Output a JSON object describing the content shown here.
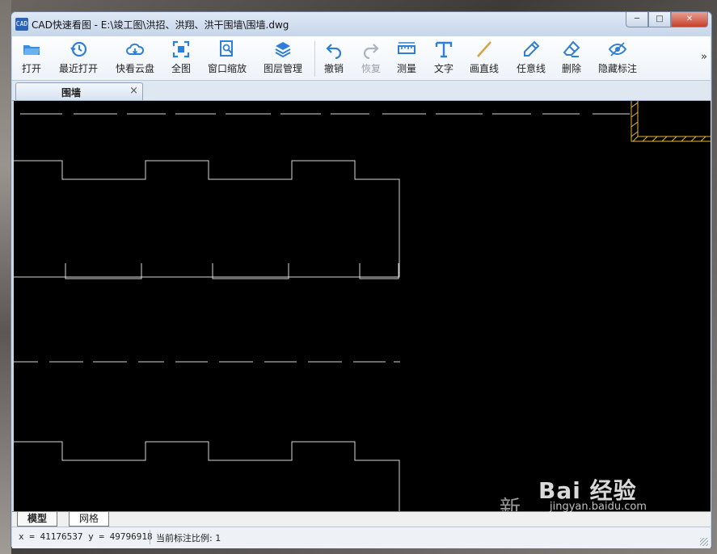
{
  "window": {
    "title": "CAD快速看图 - E:\\竣工图\\洪招、洪翔、洪干围墙\\围墙.dwg",
    "icon_text": "CAD",
    "min_label": "─",
    "max_label": "□",
    "close_label": "✕"
  },
  "toolbar": {
    "items": [
      {
        "label": "打开",
        "icon": "folder-open-icon",
        "enabled": true
      },
      {
        "label": "最近打开",
        "icon": "history-icon",
        "enabled": true
      },
      {
        "label": "快看云盘",
        "icon": "cloud-icon",
        "enabled": true
      },
      {
        "label": "全图",
        "icon": "fit-all-icon",
        "enabled": true
      },
      {
        "label": "窗口缩放",
        "icon": "zoom-window-icon",
        "enabled": true
      },
      {
        "label": "图层管理",
        "icon": "layers-icon",
        "enabled": true
      },
      {
        "label": "撤销",
        "icon": "undo-icon",
        "enabled": true
      },
      {
        "label": "恢复",
        "icon": "redo-icon",
        "enabled": false
      },
      {
        "label": "测量",
        "icon": "ruler-icon",
        "enabled": true
      },
      {
        "label": "文字",
        "icon": "text-icon",
        "enabled": true
      },
      {
        "label": "画直线",
        "icon": "line-icon",
        "enabled": true
      },
      {
        "label": "任意线",
        "icon": "pen-icon",
        "enabled": true
      },
      {
        "label": "删除",
        "icon": "eraser-icon",
        "enabled": true
      },
      {
        "label": "隐藏标注",
        "icon": "eye-icon",
        "enabled": true
      }
    ],
    "more_label": "»"
  },
  "tabs": {
    "document_tab": "围墙",
    "close_label": "×"
  },
  "canvas": {
    "background": "#000000",
    "line_color": "#d8d8d8",
    "highlight_color": "#e8b43a",
    "text_fragment": "新"
  },
  "layout_tabs": [
    {
      "label": "模型",
      "active": true
    },
    {
      "label": "网格",
      "active": false
    }
  ],
  "status": {
    "coords": "x = 41176537  y = 49796918",
    "scale_label": "当前标注比例: 1"
  },
  "watermark": {
    "text": "Bai 经验",
    "sub": "jingyan.baidu.com"
  },
  "colors": {
    "accent": "#2b63b5",
    "close_button": "#c7412b",
    "toolbar_bg": "#f6f9fc"
  }
}
